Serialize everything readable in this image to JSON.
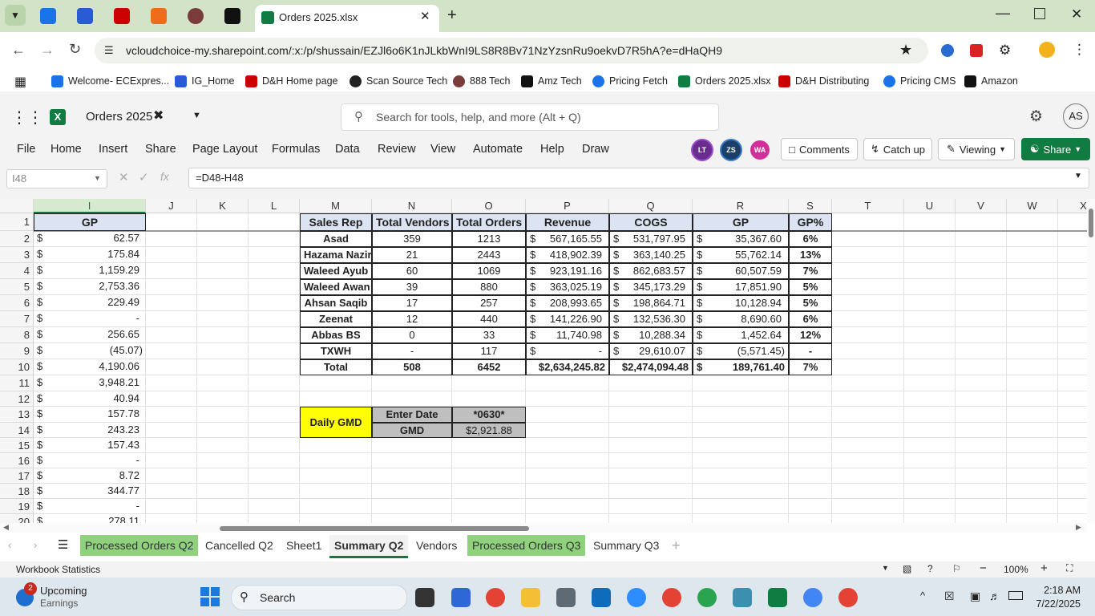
{
  "browser": {
    "active_tab_title": "Orders 2025.xlsx",
    "url": "vcloudchoice-my.sharepoint.com/:x:/p/shussain/EZJl6o6K1nJLkbWnI9LS8R8Bv71NzYzsnRu9oekvD7R5hA?e=dHaQH9",
    "bookmarks": [
      "Welcome- ECExpres...",
      "IG_Home",
      "D&H Home page",
      "Scan Source Tech",
      "888 Tech",
      "Amz Tech",
      "Pricing Fetch",
      "Orders 2025.xlsx",
      "D&H Distributing",
      "Pricing CMS",
      "Amazon"
    ]
  },
  "excel": {
    "doc_title": "Orders 2025",
    "search_placeholder": "Search for tools, help, and more (Alt + Q)",
    "user_initials": "AS",
    "menus": [
      "File",
      "Home",
      "Insert",
      "Share",
      "Page Layout",
      "Formulas",
      "Data",
      "Review",
      "View",
      "Automate",
      "Help",
      "Draw"
    ],
    "presence": [
      "LT",
      "ZS",
      "WA"
    ],
    "comments_label": "Comments",
    "catchup_label": "Catch up",
    "viewing_label": "Viewing",
    "share_label": "Share",
    "name_box": "I48",
    "formula": "=D48-H48",
    "fx_label": "fx"
  },
  "grid": {
    "columns": [
      "I",
      "J",
      "K",
      "L",
      "M",
      "N",
      "O",
      "P",
      "Q",
      "R",
      "S",
      "T",
      "U",
      "V",
      "W",
      "X"
    ],
    "rows": [
      "1",
      "2",
      "3",
      "4",
      "5",
      "6",
      "7",
      "8",
      "9",
      "10",
      "11",
      "12",
      "13",
      "14",
      "15",
      "16",
      "17",
      "18",
      "19",
      "20"
    ],
    "gp_header": "GP",
    "currency_symbol": "$",
    "gp_values": [
      "62.57",
      "175.84",
      "1,159.29",
      "2,753.36",
      "229.49",
      "-",
      "256.65",
      "(45.07)",
      "4,190.06",
      "3,948.21",
      "40.94",
      "157.78",
      "243.23",
      "157.43",
      "-",
      "8.72",
      "344.77",
      "-",
      "278.11"
    ],
    "summary_headers": [
      "Sales Rep",
      "Total Vendors",
      "Total Orders",
      "Revenue",
      "COGS",
      "GP",
      "GP%"
    ],
    "summary_rows": [
      {
        "rep": "Asad",
        "vendors": "359",
        "orders": "1213",
        "revenue": "567,165.55",
        "cogs": "531,797.95",
        "gp": "35,367.60",
        "gpp": "6%"
      },
      {
        "rep": "Hazama Nazir",
        "vendors": "21",
        "orders": "2443",
        "revenue": "418,902.39",
        "cogs": "363,140.25",
        "gp": "55,762.14",
        "gpp": "13%"
      },
      {
        "rep": "Waleed Ayub",
        "vendors": "60",
        "orders": "1069",
        "revenue": "923,191.16",
        "cogs": "862,683.57",
        "gp": "60,507.59",
        "gpp": "7%"
      },
      {
        "rep": "Waleed Awan",
        "vendors": "39",
        "orders": "880",
        "revenue": "363,025.19",
        "cogs": "345,173.29",
        "gp": "17,851.90",
        "gpp": "5%"
      },
      {
        "rep": "Ahsan Saqib",
        "vendors": "17",
        "orders": "257",
        "revenue": "208,993.65",
        "cogs": "198,864.71",
        "gp": "10,128.94",
        "gpp": "5%"
      },
      {
        "rep": "Zeenat",
        "vendors": "12",
        "orders": "440",
        "revenue": "141,226.90",
        "cogs": "132,536.30",
        "gp": "8,690.60",
        "gpp": "6%"
      },
      {
        "rep": "Abbas BS",
        "vendors": "0",
        "orders": "33",
        "revenue": "11,740.98",
        "cogs": "10,288.34",
        "gp": "1,452.64",
        "gpp": "12%"
      },
      {
        "rep": "TXWH",
        "vendors": "-",
        "orders": "117",
        "revenue": "-",
        "cogs": "29,610.07",
        "gp": "(5,571.45)",
        "gpp": "-"
      }
    ],
    "total": {
      "label": "Total",
      "vendors": "508",
      "orders": "6452",
      "revenue": "$2,634,245.82",
      "cogs": "$2,474,094.48",
      "gp": "189,761.40",
      "gpp": "7%"
    },
    "gmd": {
      "title": "Daily GMD",
      "enter_date_label": "Enter Date",
      "enter_date_value": "*0630*",
      "gmd_label": "GMD",
      "gmd_value": "$2,921.88"
    }
  },
  "sheets": [
    {
      "name": "Processed Orders Q2",
      "highlight": true
    },
    {
      "name": "Cancelled Q2",
      "highlight": false
    },
    {
      "name": "Sheet1",
      "highlight": false
    },
    {
      "name": "Summary Q2",
      "highlight": false,
      "active": true
    },
    {
      "name": "Vendors",
      "highlight": false
    },
    {
      "name": "Processed Orders Q3",
      "highlight": true
    },
    {
      "name": "Summary Q3",
      "highlight": false
    }
  ],
  "status": {
    "left": "Workbook Statistics",
    "zoom": "100%"
  },
  "taskbar": {
    "notif_count": "2",
    "widget_title": "Upcoming",
    "widget_sub": "Earnings",
    "search": "Search",
    "time": "2:18 AM",
    "date": "7/22/2025"
  },
  "colors": {
    "green_tab": "#8fd17d",
    "header_fill": "#dce3f3",
    "gmd_fill": "#ffff00",
    "gmd_grey": "#bfbfbf",
    "excel_green": "#107c41"
  }
}
